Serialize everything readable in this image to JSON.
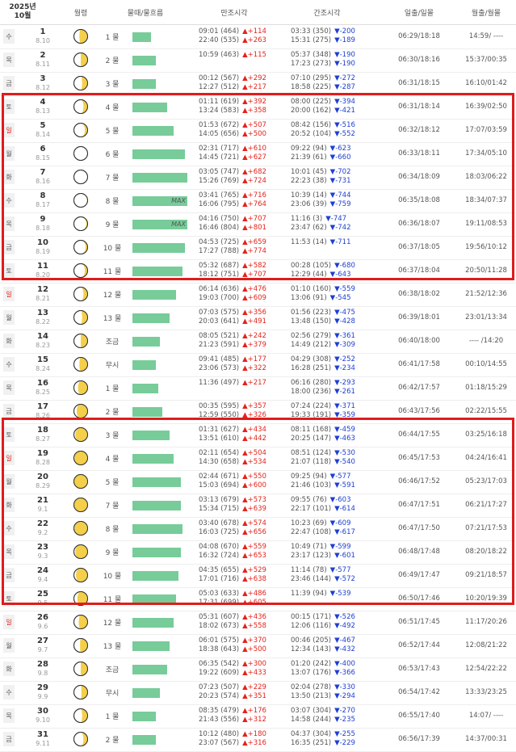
{
  "header": {
    "year": "2025년",
    "month": "10월",
    "moon_phase": "월령",
    "mul": "물때/물흐름",
    "tide_high": "만조시각",
    "tide_low": "간조시각",
    "sun": "일출/일몰",
    "moon": "월출/월몰"
  },
  "colors": {
    "bar": "#77cc99",
    "highlight": "#e01c1c",
    "rise": "#e3231b",
    "fall": "#1e3fd0"
  },
  "rows": [
    {
      "dow": "수",
      "red": false,
      "d": "1",
      "lunar": "8.10",
      "phase": 0.4,
      "mul": "1 물",
      "bar": 0.2,
      "max": "",
      "h1": "09:01 (464)",
      "h1c": "▲+114",
      "h2": "22:40 (535)",
      "h2c": "▲+263",
      "l1": "03:33 (350)",
      "l1c": "▼-200",
      "l2": "15:31 (275)",
      "l2c": "▼-189",
      "sun": "06:29/18:18",
      "moon": "14:59/ ----"
    },
    {
      "dow": "목",
      "red": false,
      "d": "2",
      "lunar": "8.11",
      "phase": 0.5,
      "mul": "2 물",
      "bar": 0.3,
      "max": "",
      "h1": "10:59 (463)",
      "h1c": "▲+115",
      "h2": "",
      "h2c": "",
      "l1": "05:37 (348)",
      "l1c": "▼-190",
      "l2": "17:23 (273)",
      "l2c": "▼-190",
      "sun": "06:30/18:16",
      "moon": "15:37/00:35"
    },
    {
      "dow": "금",
      "red": false,
      "d": "3",
      "lunar": "8.12",
      "phase": 0.6,
      "mul": "3 물",
      "bar": 0.3,
      "max": "",
      "h1": "00:12 (567)",
      "h1c": "▲+292",
      "h2": "12:27 (512)",
      "h2c": "▲+217",
      "l1": "07:10 (295)",
      "l1c": "▼-272",
      "l2": "18:58 (225)",
      "l2c": "▼-287",
      "sun": "06:31/18:15",
      "moon": "16:10/01:42"
    },
    {
      "dow": "토",
      "red": false,
      "d": "4",
      "lunar": "8.13",
      "phase": 0.7,
      "mul": "4 물",
      "bar": 0.55,
      "max": "",
      "h1": "01:11 (619)",
      "h1c": "▲+392",
      "h2": "13:24 (583)",
      "h2c": "▲+358",
      "l1": "08:00 (225)",
      "l1c": "▼-394",
      "l2": "20:00 (162)",
      "l2c": "▼-421",
      "sun": "06:31/18:14",
      "moon": "16:39/02:50"
    },
    {
      "dow": "일",
      "red": true,
      "d": "5",
      "lunar": "8.14",
      "phase": 0.8,
      "mul": "5 물",
      "bar": 0.7,
      "max": "",
      "h1": "01:53 (672)",
      "h1c": "▲+507",
      "h2": "14:05 (656)",
      "h2c": "▲+500",
      "l1": "08:42 (156)",
      "l1c": "▼-516",
      "l2": "20:52 (104)",
      "l2c": "▼-552",
      "sun": "06:32/18:12",
      "moon": "17:07/03:59"
    },
    {
      "dow": "월",
      "red": false,
      "d": "6",
      "lunar": "8.15",
      "phase": 1.0,
      "mul": "6 물",
      "bar": 0.95,
      "max": "",
      "h1": "02:31 (717)",
      "h1c": "▲+610",
      "h2": "14:45 (721)",
      "h2c": "▲+627",
      "l1": "09:22 (94)",
      "l1c": "▼-623",
      "l2": "21:39 (61)",
      "l2c": "▼-660",
      "sun": "06:33/18:11",
      "moon": "17:34/05:10"
    },
    {
      "dow": "화",
      "red": false,
      "d": "7",
      "lunar": "8.16",
      "phase": 1.0,
      "mul": "7 물",
      "bar": 1.0,
      "max": "",
      "h1": "03:05 (747)",
      "h1c": "▲+682",
      "h2": "15:26 (769)",
      "h2c": "▲+724",
      "l1": "10:01 (45)",
      "l1c": "▼-702",
      "l2": "22:23 (38)",
      "l2c": "▼-731",
      "sun": "06:34/18:09",
      "moon": "18:03/06:22"
    },
    {
      "dow": "수",
      "red": false,
      "d": "8",
      "lunar": "8.17",
      "phase": 0.95,
      "mul": "8 물",
      "bar": 1.0,
      "max": "MAX",
      "h1": "03:41 (765)",
      "h1c": "▲+716",
      "h2": "16:06 (795)",
      "h2c": "▲+764",
      "l1": "10:39 (14)",
      "l1c": "▼-744",
      "l2": "23:06 (39)",
      "l2c": "▼-759",
      "sun": "06:35/18:08",
      "moon": "18:34/07:37"
    },
    {
      "dow": "목",
      "red": false,
      "d": "9",
      "lunar": "8.18",
      "phase": 0.9,
      "mul": "9 물",
      "bar": 1.0,
      "max": "MAX",
      "h1": "04:16 (750)",
      "h1c": "▲+707",
      "h2": "16:46 (804)",
      "h2c": "▲+801",
      "l1": "11:16 (3)",
      "l1c": "▼-747",
      "l2": "23:47 (62)",
      "l2c": "▼-742",
      "sun": "06:36/18:07",
      "moon": "19:11/08:53"
    },
    {
      "dow": "금",
      "red": false,
      "d": "10",
      "lunar": "8.19",
      "phase": 0.85,
      "mul": "10 물",
      "bar": 0.95,
      "max": "",
      "h1": "04:53 (725)",
      "h1c": "▲+659",
      "h2": "17:27 (788)",
      "h2c": "▲+774",
      "l1": "11:53 (14)",
      "l1c": "▼-711",
      "l2": "",
      "l2c": "",
      "sun": "06:37/18:05",
      "moon": "19:56/10:12"
    },
    {
      "dow": "토",
      "red": false,
      "d": "11",
      "lunar": "8.20",
      "phase": 0.8,
      "mul": "11 물",
      "bar": 0.9,
      "max": "",
      "h1": "05:32 (687)",
      "h1c": "▲+582",
      "h2": "18:12 (751)",
      "h2c": "▲+707",
      "l1": "00:28 (105)",
      "l1c": "▼-680",
      "l2": "12:29 (44)",
      "l2c": "▼-643",
      "sun": "06:37/18:04",
      "moon": "20:50/11:28"
    },
    {
      "dow": "일",
      "red": true,
      "d": "12",
      "lunar": "8.21",
      "phase": 0.7,
      "mul": "12 물",
      "bar": 0.75,
      "max": "",
      "h1": "06:14 (636)",
      "h1c": "▲+476",
      "h2": "19:03 (700)",
      "h2c": "▲+609",
      "l1": "01:10 (160)",
      "l1c": "▼-559",
      "l2": "13:06 (91)",
      "l2c": "▼-545",
      "sun": "06:38/18:02",
      "moon": "21:52/12:36"
    },
    {
      "dow": "월",
      "red": false,
      "d": "13",
      "lunar": "8.22",
      "phase": 0.6,
      "mul": "13 물",
      "bar": 0.6,
      "max": "",
      "h1": "07:03 (575)",
      "h1c": "▲+356",
      "h2": "20:03 (641)",
      "h2c": "▲+491",
      "l1": "01:56 (223)",
      "l1c": "▼-475",
      "l2": "13:48 (150)",
      "l2c": "▼-428",
      "sun": "06:39/18:01",
      "moon": "23:01/13:34"
    },
    {
      "dow": "화",
      "red": false,
      "d": "14",
      "lunar": "8.23",
      "phase": 0.5,
      "mul": "조금",
      "bar": 0.4,
      "max": "",
      "h1": "08:05 (521)",
      "h1c": "▲+242",
      "h2": "21:23 (591)",
      "h2c": "▲+379",
      "l1": "02:56 (279)",
      "l1c": "▼-361",
      "l2": "14:49 (212)",
      "l2c": "▼-309",
      "sun": "06:40/18:00",
      "moon": "---- /14:20"
    },
    {
      "dow": "수",
      "red": false,
      "d": "15",
      "lunar": "8.24",
      "phase": 0.4,
      "mul": "무시",
      "bar": 0.3,
      "max": "",
      "h1": "09:41 (485)",
      "h1c": "▲+177",
      "h2": "23:06 (573)",
      "h2c": "▲+322",
      "l1": "04:29 (308)",
      "l1c": "▼-252",
      "l2": "16:28 (251)",
      "l2c": "▼-234",
      "sun": "06:41/17:58",
      "moon": "00:10/14:55"
    },
    {
      "dow": "목",
      "red": false,
      "d": "16",
      "lunar": "8.25",
      "phase": 0.3,
      "mul": "1 물",
      "bar": 0.35,
      "max": "",
      "h1": "11:36 (497)",
      "h1c": "▲+217",
      "h2": "",
      "h2c": "",
      "l1": "06:16 (280)",
      "l1c": "▼-293",
      "l2": "18:00 (236)",
      "l2c": "▼-261",
      "sun": "06:42/17:57",
      "moon": "01:18/15:29"
    },
    {
      "dow": "금",
      "red": false,
      "d": "17",
      "lunar": "8.26",
      "phase": 0.2,
      "mul": "2 물",
      "bar": 0.45,
      "max": "",
      "h1": "00:35 (595)",
      "h1c": "▲+357",
      "h2": "12:59 (550)",
      "h2c": "▲+326",
      "l1": "07:24 (224)",
      "l1c": "▼-371",
      "l2": "19:33 (191)",
      "l2c": "▼-359",
      "sun": "06:43/17:56",
      "moon": "02:22/15:55"
    },
    {
      "dow": "토",
      "red": false,
      "d": "18",
      "lunar": "8.27",
      "phase": 0.1,
      "mul": "3 물",
      "bar": 0.6,
      "max": "",
      "h1": "01:31 (627)",
      "h1c": "▲+434",
      "h2": "13:51 (610)",
      "h2c": "▲+442",
      "l1": "08:11 (168)",
      "l1c": "▼-459",
      "l2": "20:25 (147)",
      "l2c": "▼-463",
      "sun": "06:44/17:55",
      "moon": "03:25/16:18"
    },
    {
      "dow": "일",
      "red": true,
      "d": "19",
      "lunar": "8.28",
      "phase": 0.05,
      "mul": "4 물",
      "bar": 0.7,
      "max": "",
      "h1": "02:11 (654)",
      "h1c": "▲+504",
      "h2": "14:30 (658)",
      "h2c": "▲+534",
      "l1": "08:51 (124)",
      "l1c": "▼-530",
      "l2": "21:07 (118)",
      "l2c": "▼-540",
      "sun": "06:45/17:53",
      "moon": "04:24/16:41"
    },
    {
      "dow": "월",
      "red": false,
      "d": "20",
      "lunar": "8.29",
      "phase": 0.02,
      "mul": "5 물",
      "bar": 0.85,
      "max": "",
      "h1": "02:44 (671)",
      "h1c": "▲+550",
      "h2": "15:03 (694)",
      "h2c": "▲+600",
      "l1": "09:25 (94)",
      "l1c": "▼-577",
      "l2": "21:46 (103)",
      "l2c": "▼-591",
      "sun": "06:46/17:52",
      "moon": "05:23/17:03"
    },
    {
      "dow": "화",
      "red": false,
      "d": "21",
      "lunar": "9.1",
      "phase": 0.0,
      "mul": "7 물",
      "bar": 0.85,
      "max": "",
      "h1": "03:13 (679)",
      "h1c": "▲+573",
      "h2": "15:34 (715)",
      "h2c": "▲+639",
      "l1": "09:55 (76)",
      "l1c": "▼-603",
      "l2": "22:17 (101)",
      "l2c": "▼-614",
      "sun": "06:47/17:51",
      "moon": "06:21/17:27"
    },
    {
      "dow": "수",
      "red": false,
      "d": "22",
      "lunar": "9.2",
      "phase": 0.05,
      "mul": "8 물",
      "bar": 0.9,
      "max": "",
      "h1": "03:40 (678)",
      "h1c": "▲+574",
      "h2": "16:03 (725)",
      "h2c": "▲+656",
      "l1": "10:23 (69)",
      "l1c": "▼-609",
      "l2": "22:47 (108)",
      "l2c": "▼-617",
      "sun": "06:47/17:50",
      "moon": "07:21/17:53"
    },
    {
      "dow": "목",
      "red": false,
      "d": "23",
      "lunar": "9.3",
      "phase": 0.1,
      "mul": "9 물",
      "bar": 0.85,
      "max": "",
      "h1": "04:08 (670)",
      "h1c": "▲+559",
      "h2": "16:32 (724)",
      "h2c": "▲+653",
      "l1": "10:49 (71)",
      "l1c": "▼-599",
      "l2": "23:17 (123)",
      "l2c": "▼-601",
      "sun": "06:48/17:48",
      "moon": "08:20/18:22"
    },
    {
      "dow": "금",
      "red": false,
      "d": "24",
      "lunar": "9.4",
      "phase": 0.15,
      "mul": "10 물",
      "bar": 0.8,
      "max": "",
      "h1": "04:35 (655)",
      "h1c": "▲+529",
      "h2": "17:01 (716)",
      "h2c": "▲+638",
      "l1": "11:14 (78)",
      "l1c": "▼-577",
      "l2": "23:46 (144)",
      "l2c": "▼-572",
      "sun": "06:49/17:47",
      "moon": "09:21/18:57"
    },
    {
      "dow": "토",
      "red": false,
      "d": "25",
      "lunar": "9.5",
      "phase": 0.25,
      "mul": "11 물",
      "bar": 0.75,
      "max": "",
      "h1": "05:03 (633)",
      "h1c": "▲+486",
      "h2": "17:31 (699)",
      "h2c": "▲+605",
      "l1": "11:39 (94)",
      "l1c": "▼-539",
      "l2": "",
      "l2c": "",
      "sun": "06:50/17:46",
      "moon": "10:20/19:39"
    },
    {
      "dow": "일",
      "red": true,
      "d": "26",
      "lunar": "9.6",
      "phase": 0.35,
      "mul": "12 물",
      "bar": 0.7,
      "max": "",
      "h1": "05:31 (607)",
      "h1c": "▲+436",
      "h2": "18:02 (673)",
      "h2c": "▲+558",
      "l1": "00:15 (171)",
      "l1c": "▼-526",
      "l2": "12:06 (116)",
      "l2c": "▼-492",
      "sun": "06:51/17:45",
      "moon": "11:17/20:26"
    },
    {
      "dow": "월",
      "red": false,
      "d": "27",
      "lunar": "9.7",
      "phase": 0.45,
      "mul": "13 물",
      "bar": 0.6,
      "max": "",
      "h1": "06:01 (575)",
      "h1c": "▲+370",
      "h2": "18:38 (643)",
      "h2c": "▲+500",
      "l1": "00:46 (205)",
      "l1c": "▼-467",
      "l2": "12:34 (143)",
      "l2c": "▼-432",
      "sun": "06:52/17:44",
      "moon": "12:08/21:22"
    },
    {
      "dow": "화",
      "red": false,
      "d": "28",
      "lunar": "9.8",
      "phase": 0.5,
      "mul": "조금",
      "bar": 0.55,
      "max": "",
      "h1": "06:35 (542)",
      "h1c": "▲+300",
      "h2": "19:22 (609)",
      "h2c": "▲+433",
      "l1": "01:20 (242)",
      "l1c": "▼-400",
      "l2": "13:07 (176)",
      "l2c": "▼-366",
      "sun": "06:53/17:43",
      "moon": "12:54/22:22"
    },
    {
      "dow": "수",
      "red": false,
      "d": "29",
      "lunar": "9.9",
      "phase": 0.55,
      "mul": "무시",
      "bar": 0.4,
      "max": "",
      "h1": "07:23 (507)",
      "h1c": "▲+229",
      "h2": "20:23 (574)",
      "h2c": "▲+351",
      "l1": "02:04 (278)",
      "l1c": "▼-330",
      "l2": "13:50 (213)",
      "l2c": "▼-294",
      "sun": "06:54/17:42",
      "moon": "13:33/23:25"
    },
    {
      "dow": "목",
      "red": false,
      "d": "30",
      "lunar": "9.10",
      "phase": 0.6,
      "mul": "1 물",
      "bar": 0.3,
      "max": "",
      "h1": "08:35 (479)",
      "h1c": "▲+176",
      "h2": "21:43 (556)",
      "h2c": "▲+312",
      "l1": "03:07 (304)",
      "l1c": "▼-270",
      "l2": "14:58 (244)",
      "l2c": "▼-235",
      "sun": "06:55/17:40",
      "moon": "14:07/ ----"
    },
    {
      "dow": "금",
      "red": false,
      "d": "31",
      "lunar": "9.11",
      "phase": 0.7,
      "mul": "2 물",
      "bar": 0.3,
      "max": "",
      "h1": "10:12 (480)",
      "h1c": "▲+180",
      "h2": "23:07 (567)",
      "h2c": "▲+316",
      "l1": "04:37 (304)",
      "l1c": "▼-255",
      "l2": "16:35 (251)",
      "l2c": "▼-229",
      "sun": "06:56/17:39",
      "moon": "14:37/00:31"
    }
  ]
}
